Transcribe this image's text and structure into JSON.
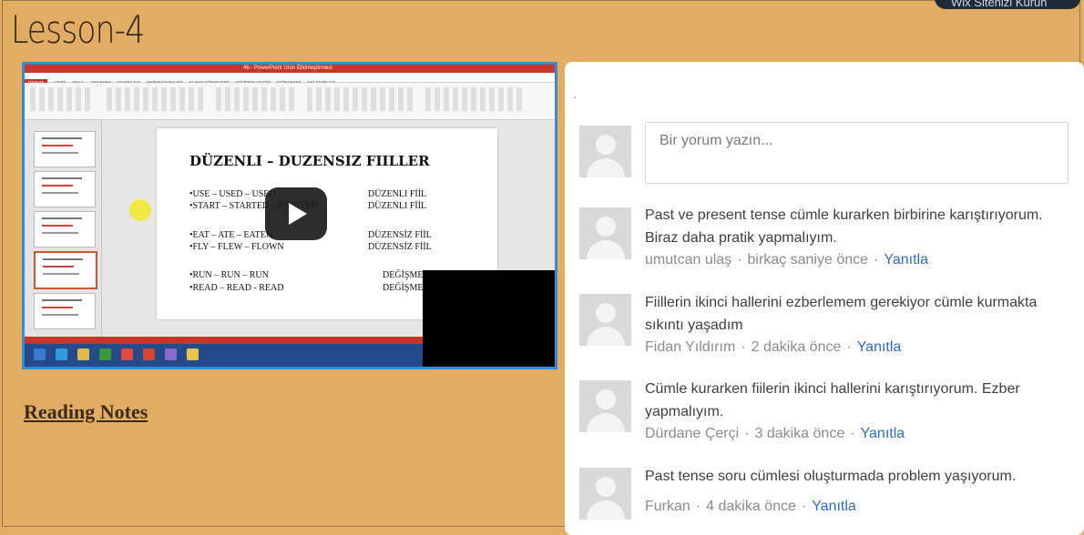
{
  "page": {
    "title": "Lesson-4",
    "badge": "Wix Sitenizi Kurun"
  },
  "video": {
    "ppt_title": "4b - PowerPoint Ürün Etkinleştirmesi",
    "ppt_tabs": [
      "DOSYA",
      "GİRİŞ",
      "EKLE",
      "TASARIM",
      "GEÇİŞLER",
      "ANİMASYONLAR",
      "SLAYT GÖSTERİSİ",
      "GÖZDEN GEÇİR",
      "GÖRÜNÜM",
      "EKLENTİLER"
    ],
    "slide": {
      "title": "DÜZENLI – DUZENSIZ FIILLER",
      "rows": [
        {
          "left": "•USE – USED – USED",
          "right": "DÜZENLI FİİL"
        },
        {
          "left": "•START – STARTED – STARTED",
          "right": "DÜZENLI FİİL"
        },
        {
          "left": "•EAT – ATE – EATEN",
          "right": "DÜZENSİZ FİİL"
        },
        {
          "left": "•FLY – FLEW – FLOWN",
          "right": "DÜZENSİZ FİİL"
        },
        {
          "left": "•RUN – RUN – RUN",
          "right": "DEĞİŞMEZ"
        },
        {
          "left": "•READ – READ - READ",
          "right": "DEĞİŞMEZ"
        }
      ]
    },
    "play_icon": "play-icon"
  },
  "reading_notes": "Reading Notes",
  "comments": {
    "input_placeholder": "Bir yorum yazın...",
    "reply_label": "Yanıtla",
    "items": [
      {
        "text": "Past ve present tense cümle kurarken birbirine karıştırıyorum. Biraz daha pratik yapmalıyım.",
        "author": "umutcan ulaş",
        "time": "birkaç saniye önce"
      },
      {
        "text": "Fiillerin ikinci hallerini ezberlemem gerekiyor cümle kurmakta sıkıntı yaşadım",
        "author": "Fidan Yıldırım",
        "time": "2 dakika önce"
      },
      {
        "text": "Cümle kurarken fiilerin ikinci hallerini karıştırıyorum. Ezber yapmalıyım.",
        "author": "Dürdane Çerçi",
        "time": "3 dakika önce"
      },
      {
        "text": "Past tense soru cümlesi oluşturmada problem yaşıyorum.",
        "author": "Furkan",
        "time": "4 dakika önce"
      }
    ]
  },
  "colors": {
    "page_bg": "#e2ad63",
    "reply": "#2e6cc0",
    "video_border": "#2c8fd8"
  }
}
